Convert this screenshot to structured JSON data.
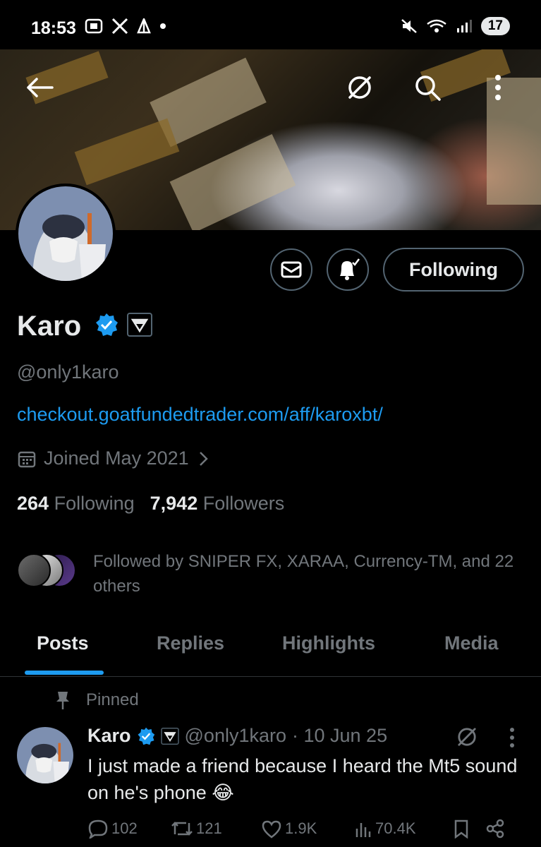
{
  "status_bar": {
    "time": "18:53",
    "battery": "17"
  },
  "profile": {
    "name": "Karo",
    "handle": "@only1karo",
    "link": "checkout.goatfundedtrader.com/aff/karoxbt/",
    "joined": "Joined May 2021",
    "following_count": "264",
    "following_label": "Following",
    "followers_count": "7,942",
    "followers_label": "Followers",
    "followed_by": "Followed by SNIPER FX, XARAA, Currency-TM, and 22 others",
    "follow_button": "Following"
  },
  "tabs": [
    {
      "label": "Posts",
      "active": true
    },
    {
      "label": "Replies"
    },
    {
      "label": "Highlights"
    },
    {
      "label": "Media"
    }
  ],
  "post": {
    "pinned_label": "Pinned",
    "author": "Karo",
    "handle": "@only1karo",
    "date": "· 10 Jun 25",
    "text": "I just made a friend because I heard the Mt5 sound on he's phone 😂",
    "replies": "102",
    "reposts": "121",
    "likes": "1.9K",
    "views": "70.4K"
  },
  "colors": {
    "accent": "#1d9bf0",
    "muted": "#71767b",
    "text": "#e7e9ea",
    "background": "#000000"
  },
  "icons": [
    "back-arrow-icon",
    "grok-icon",
    "search-icon",
    "more-icon",
    "message-icon",
    "notification-bell-icon",
    "verified-badge-icon",
    "affiliate-badge-icon",
    "calendar-icon",
    "chevron-right-icon",
    "pin-icon",
    "reply-icon",
    "repost-icon",
    "like-icon",
    "views-icon",
    "bookmark-icon",
    "share-icon"
  ]
}
